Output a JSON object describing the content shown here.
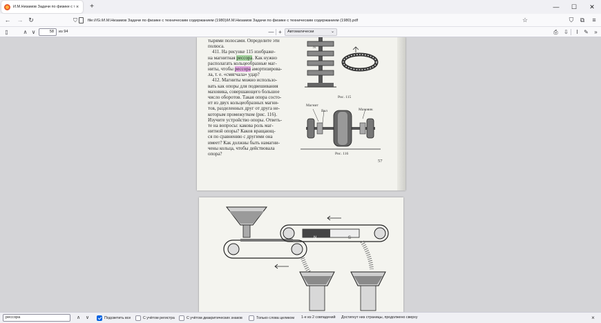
{
  "browser": {
    "tab_title": "И.М.Низамов Задачи по физике с техническим содержанием (1980)/И.М.Низамов Задачи по физике с техническим содержанием (1980).pdf",
    "tab_close": "×",
    "new_tab": "+",
    "url": "file:///G:/И.М.Низамов Задачи по физике с техническим содержанием (1980)/И.М.Низамов Задачи по физике с техническим содержанием (1980).pdf",
    "window_controls": {
      "minimize": "—",
      "maximize": "☐",
      "close": "✕"
    }
  },
  "pdf_toolbar": {
    "current_page": "58",
    "page_count": "из 94",
    "zoom_minus": "—",
    "zoom_plus": "+",
    "zoom_value": "Автоматически"
  },
  "document": {
    "page1": {
      "lines": [
        "тырями полосами. Определите эти",
        "полюса."
      ],
      "q411_pre": "411. На рисунке 115 изображе-",
      "q411_l2_pre": "на магнитная ",
      "q411_l2_hl": "рессора",
      "q411_l2_post": ". Как нужно",
      "q411_l3": "располагать кольцеобразные маг-",
      "q411_l4_pre": "ниты, чтобы ",
      "q411_l4_hl": "рессора",
      "q411_l4_post": " амортизирова-",
      "q411_l5": "ла, т. е. «смягчала» удар?",
      "q412": [
        "412. Магниты можно использо-",
        "вать как опоры для подвешивания",
        "маховика, совершающего большое",
        "число оборотов. Такая опора состо-",
        "ит из двух кольцеобразных магни-",
        "тов, разделенных друг от друга не-",
        "которым промежутком (рис. 116).",
        "Изучите устройство опоры. Ответь-",
        "те на вопросы: какова роль маг-",
        "нитной опоры? Каков вращающ-",
        "ся по сравнению с другими она",
        "имеет? Как должны быть намагни-",
        "чены кольца, чтобы действовала",
        "опора?"
      ],
      "fig115_caption": "Рис. 115",
      "fig116_caption": "Рис. 116",
      "fig116_label_left": "Магнит",
      "fig116_label_mid": "Вал",
      "fig116_label_right": "Маховик",
      "fig115_label": "N",
      "page_number": "57"
    },
    "page2": {
      "magnet_n": "N",
      "magnet_s": "S"
    }
  },
  "find_bar": {
    "query": "рессора",
    "prev": "∧",
    "next": "∨",
    "highlight_all": {
      "label": "Подсветить все",
      "checked": true
    },
    "match_case": {
      "label": "С учётом регистра",
      "checked": false
    },
    "match_diacritics": {
      "label": "С учётом диакритических знаков",
      "checked": false
    },
    "whole_words": {
      "label": "Только слова целиком",
      "checked": false
    },
    "match_count": "1-е из 2 совпадений",
    "status": "Достигнут низ страницы, продолжено сверху",
    "close": "×"
  },
  "colors": {
    "highlight_green": "#a5d6a0",
    "highlight_purple": "#e3a8e3",
    "accent": "#0061e0"
  }
}
